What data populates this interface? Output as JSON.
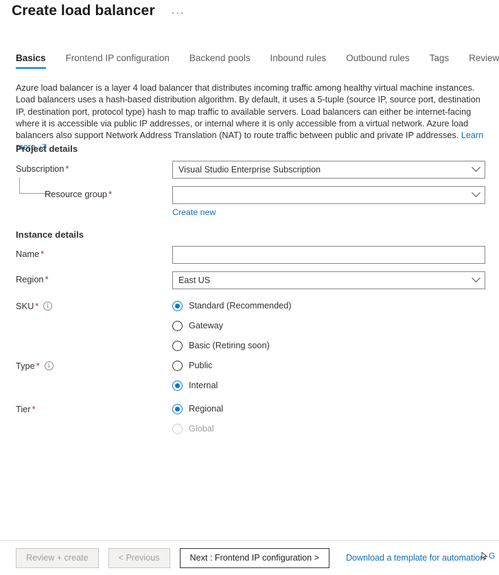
{
  "header": {
    "title": "Create load balancer",
    "overflow_label": "···"
  },
  "tabs": [
    {
      "label": "Basics",
      "active": true
    },
    {
      "label": "Frontend IP configuration",
      "active": false
    },
    {
      "label": "Backend pools",
      "active": false
    },
    {
      "label": "Inbound rules",
      "active": false
    },
    {
      "label": "Outbound rules",
      "active": false
    },
    {
      "label": "Tags",
      "active": false
    },
    {
      "label": "Review + create",
      "active": false
    }
  ],
  "intro": {
    "text": "Azure load balancer is a layer 4 load balancer that distributes incoming traffic among healthy virtual machine instances. Load balancers uses a hash-based distribution algorithm. By default, it uses a 5-tuple (source IP, source port, destination IP, destination port, protocol type) hash to map traffic to available servers. Load balancers can either be internet-facing where it is accessible via public IP addresses, or internal where it is only accessible from a virtual network. Azure load balancers also support Network Address Translation (NAT) to route traffic between public and private IP addresses.",
    "learn_more": "Learn more."
  },
  "project_details": {
    "heading": "Project details",
    "subscription": {
      "label": "Subscription",
      "required": "*",
      "value": "Visual Studio Enterprise Subscription"
    },
    "resource_group": {
      "label": "Resource group",
      "required": "*",
      "value": "",
      "create_new": "Create new"
    }
  },
  "instance_details": {
    "heading": "Instance details",
    "name": {
      "label": "Name",
      "required": "*",
      "value": "",
      "placeholder": ""
    },
    "region": {
      "label": "Region",
      "required": "*",
      "value": "East US"
    },
    "sku": {
      "label": "SKU",
      "required": "*",
      "info_icon": "info-icon",
      "options": [
        {
          "label": "Standard (Recommended)",
          "selected": true,
          "disabled": false
        },
        {
          "label": "Gateway",
          "selected": false,
          "disabled": false
        },
        {
          "label": "Basic (Retiring soon)",
          "selected": false,
          "disabled": false
        }
      ]
    },
    "type": {
      "label": "Type",
      "required": "*",
      "info_icon": "info-icon",
      "options": [
        {
          "label": "Public",
          "selected": false,
          "disabled": false
        },
        {
          "label": "Internal",
          "selected": true,
          "disabled": false
        }
      ]
    },
    "tier": {
      "label": "Tier",
      "required": "*",
      "options": [
        {
          "label": "Regional",
          "selected": true,
          "disabled": false
        },
        {
          "label": "Global",
          "selected": false,
          "disabled": true
        }
      ]
    }
  },
  "footer": {
    "review_create": "Review + create",
    "previous": "< Previous",
    "next": "Next : Frontend IP configuration >",
    "download_template": "Download a template for automation",
    "trailing_text": "G"
  },
  "colors": {
    "accent": "#0078d4",
    "link": "#0f6cbd",
    "required": "#a4262c",
    "text": "#323130",
    "disabled_text": "#a19f9d",
    "border": "#8a8886"
  }
}
